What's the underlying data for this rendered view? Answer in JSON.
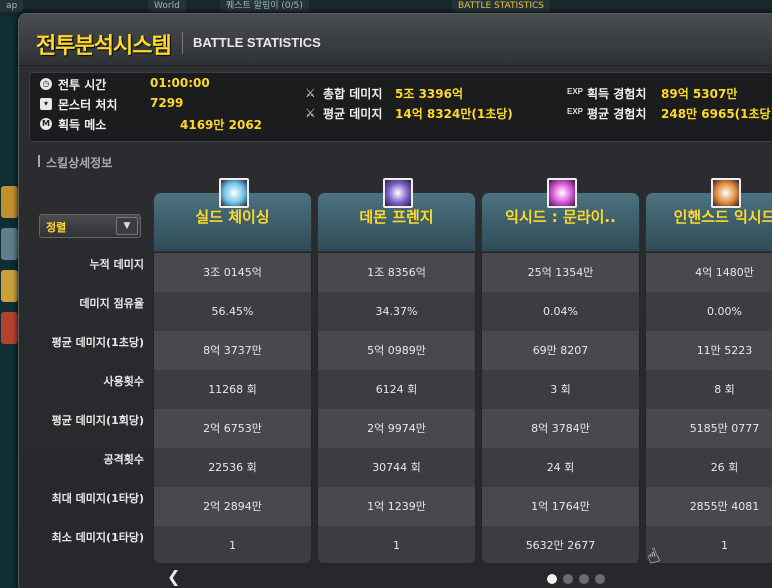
{
  "background": {
    "tabs": [
      "ap",
      "World",
      "퀘스트 알림이 (0/5)",
      "BATTLE STATISTICS"
    ]
  },
  "window": {
    "title": "전투분석시스템",
    "subtitle": "BATTLE STATISTICS"
  },
  "summary": {
    "battle_time_label": "전투 시간",
    "battle_time_value": "01:00:00",
    "monsters_label": "몬스터 처치",
    "monsters_value": "7299",
    "meso_label": "획득 메소",
    "meso_value": "4169만 2062",
    "total_damage_label": "총합 데미지",
    "total_damage_value": "5조 3396억",
    "avg_damage_label": "평균 데미지",
    "avg_damage_value": "14억 8324만(1초당)",
    "exp_tag": "EXP",
    "exp_gained_label": "획득 경험치",
    "exp_gained_value": "89억 5307만",
    "avg_exp_label": "평균 경험치",
    "avg_exp_value": "248만 6965(1초당)",
    "icons": {
      "clock": "clock-icon",
      "monster": "monster-icon",
      "meso": "meso-coin-icon",
      "sword": "sword-icon"
    }
  },
  "skills": {
    "section_label": "스킬상세정보",
    "sort_label": "정렬",
    "row_labels": [
      "누적 데미지",
      "데미지 점유율",
      "평균 데미지(1초당)",
      "사용횟수",
      "평균 데미지(1회당)",
      "공격횟수",
      "최대 데미지(1타당)",
      "최소 데미지(1타당)"
    ],
    "columns": [
      {
        "name": "실드 체이싱",
        "icon": "shield-chasing-skill-icon",
        "icon_color": "#6fc2e6",
        "values": [
          "3조 0145억",
          "56.45%",
          "8억 3737만",
          "11268 회",
          "2억 6753만",
          "22536 회",
          "2억 2894만",
          "1"
        ]
      },
      {
        "name": "데몬 프렌지",
        "icon": "demon-frenzy-skill-icon",
        "icon_color": "#7a5cc8",
        "values": [
          "1조 8356억",
          "34.37%",
          "5억 0989만",
          "6124 회",
          "2억 9974만",
          "30744 회",
          "1억 1239만",
          "1"
        ]
      },
      {
        "name": "익시드 : 문라이..",
        "icon": "exceed-moonlight-skill-icon",
        "icon_color": "#d64fd6",
        "values": [
          "25억 1354만",
          "0.04%",
          "69만 8207",
          "3 회",
          "8억 3784만",
          "24 회",
          "1억 1764만",
          "5632만 2677"
        ]
      },
      {
        "name": "인핸스드 익시드",
        "icon": "enhanced-exceed-skill-icon",
        "icon_color": "#e0883a",
        "values": [
          "4억 1480만",
          "0.00%",
          "11만 5223",
          "8 회",
          "5185만 0777",
          "26 회",
          "2855만 4081",
          "1"
        ]
      }
    ]
  },
  "pagination": {
    "pages": 4,
    "current": 1
  }
}
